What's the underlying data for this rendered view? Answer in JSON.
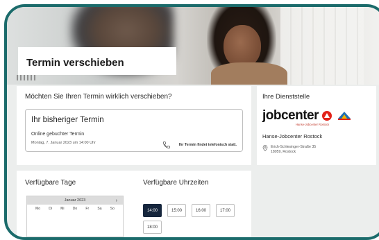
{
  "page": {
    "title": "Termin verschieben"
  },
  "question": {
    "text": "Möchten Sie Ihren Termin wirklich verschieben?",
    "box_title": "Ihr bisheriger Termin",
    "type": "Online gebuchter Termin",
    "datetime": "Montag, 7. Januar 2023 um 14:00 Uhr",
    "phone_icon": "phone-icon",
    "phone_note": "Ihr Termin findet telefonisch statt."
  },
  "office": {
    "heading": "Ihre Dienststelle",
    "logo_text": "jobcenter",
    "logo_subtext": "Hanse-Jobcenter Rostock",
    "name": "Hanse-Jobcenter Rostock",
    "pin_icon": "map-pin-icon",
    "street": "Erich-Schlesinger-Straße 35",
    "city": "18059, Rostock"
  },
  "days": {
    "heading": "Verfügbare Tage",
    "month": "Januar 2023",
    "next_icon": "chevron-right-icon",
    "next_label": "›",
    "weekdays": [
      "Mo",
      "Di",
      "Mi",
      "Do",
      "Fr",
      "Sa",
      "So"
    ]
  },
  "times": {
    "heading": "Verfügbare Uhrzeiten",
    "slots": [
      "14:00",
      "15:00",
      "16:00",
      "17:00",
      "18:00"
    ],
    "selected": "14:00"
  },
  "colors": {
    "frame": "#1b6b6b",
    "selected_slot": "#16263d",
    "logo_accent": "#e2231a"
  }
}
